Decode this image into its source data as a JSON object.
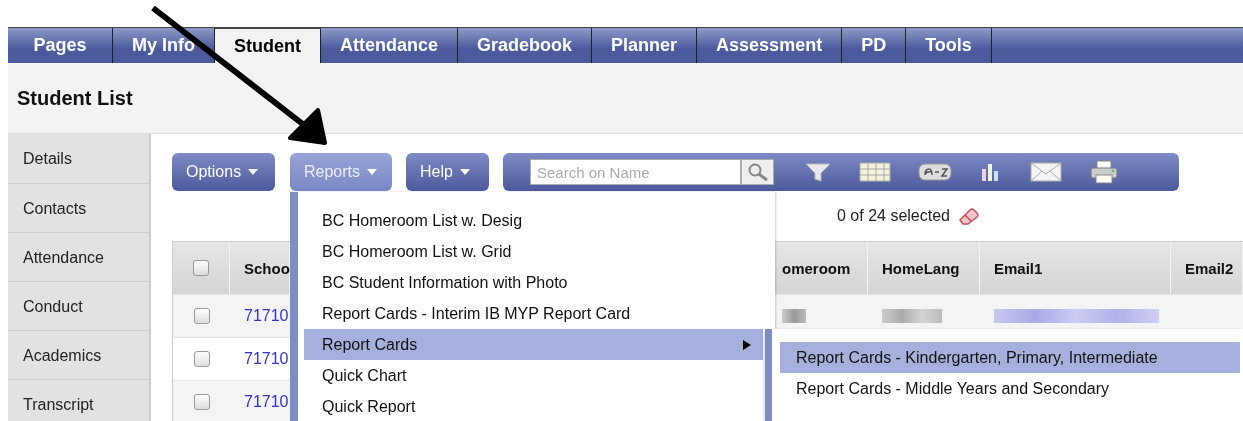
{
  "tabs": [
    {
      "label": "Pages",
      "selected": false
    },
    {
      "label": "My Info",
      "selected": false
    },
    {
      "label": "Student",
      "selected": true
    },
    {
      "label": "Attendance",
      "selected": false
    },
    {
      "label": "Gradebook",
      "selected": false
    },
    {
      "label": "Planner",
      "selected": false
    },
    {
      "label": "Assessment",
      "selected": false
    },
    {
      "label": "PD",
      "selected": false
    },
    {
      "label": "Tools",
      "selected": false
    }
  ],
  "page_title": "Student List",
  "sidebar": {
    "items": [
      "Details",
      "Contacts",
      "Attendance",
      "Conduct",
      "Academics",
      "Transcript"
    ]
  },
  "toolbar": {
    "buttons": [
      {
        "label": "Options",
        "active": false
      },
      {
        "label": "Reports",
        "active": true
      },
      {
        "label": "Help",
        "active": false
      }
    ],
    "search": {
      "placeholder": "Search on Name"
    }
  },
  "selection_count": "0 of 24 selected",
  "table": {
    "select_all_checked": false,
    "columns": [
      "Schoo",
      "omeroom",
      "HomeLang",
      "Email1",
      "Email2"
    ],
    "rows": [
      {
        "checked": false,
        "column_1": "71710",
        "redacted": true
      },
      {
        "checked": false,
        "column_1": "71710"
      },
      {
        "checked": false,
        "column_1": "71710"
      }
    ]
  },
  "reports_menu": {
    "items": [
      {
        "label": "BC Homeroom List w. Desig",
        "selected": false,
        "has_submenu": false
      },
      {
        "label": "BC Homeroom List w. Grid",
        "selected": false,
        "has_submenu": false
      },
      {
        "label": "BC Student Information with Photo",
        "selected": false,
        "has_submenu": false
      },
      {
        "label": "Report Cards - Interim IB MYP Report Card",
        "selected": false,
        "has_submenu": false
      },
      {
        "label": "Report Cards",
        "selected": true,
        "has_submenu": true
      },
      {
        "label": "Quick Chart",
        "selected": false,
        "has_submenu": false
      },
      {
        "label": "Quick Report",
        "selected": false,
        "has_submenu": false
      }
    ]
  },
  "submenu": {
    "items": [
      {
        "label": "Report Cards - Kindergarten, Primary, Intermediate",
        "selected": true
      },
      {
        "label": "Report Cards - Middle Years and Secondary",
        "selected": false
      }
    ]
  }
}
